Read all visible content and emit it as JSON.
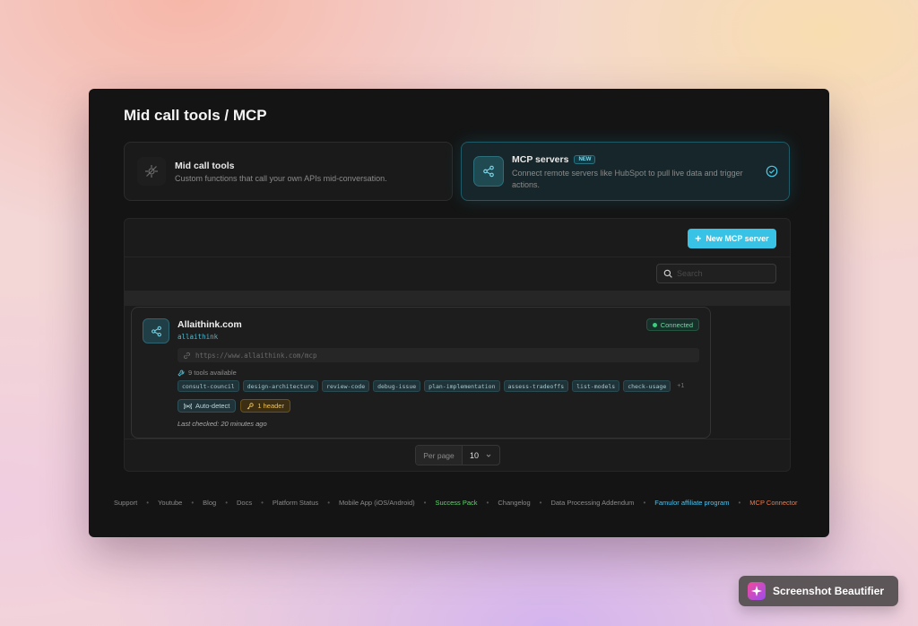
{
  "page": {
    "title": "Mid call tools / MCP"
  },
  "options": [
    {
      "title": "Mid call tools",
      "description": "Custom functions that call your own APIs mid-conversation.",
      "icon": "network-off-icon"
    },
    {
      "title": "MCP servers",
      "badge": "NEW",
      "description": "Connect remote servers like HubSpot to pull live data and trigger actions.",
      "icon": "share-icon",
      "selected": true
    }
  ],
  "toolbar": {
    "new_button_label": "New MCP server"
  },
  "search": {
    "placeholder": "Search"
  },
  "server": {
    "name": "Allaithink.com",
    "slug": "allaithink",
    "status": "Connected",
    "url": "https://www.allaithink.com/mcp",
    "tools_count": "9 tools available",
    "tools": [
      "consult-council",
      "design-architecture",
      "review-code",
      "debug-issue",
      "plan-implementation",
      "assess-tradeoffs",
      "list-models",
      "check-usage"
    ],
    "tools_more": "+1",
    "auto_detect": "Auto-detect",
    "headers": "1 header",
    "last_checked": "Last checked: 20 minutes ago"
  },
  "pagination": {
    "label": "Per page",
    "value": "10"
  },
  "footer": {
    "links": [
      "Support",
      "Youtube",
      "Blog",
      "Docs",
      "Platform Status",
      "Mobile App (iOS/Android)",
      "Success Pack",
      "Changelog",
      "Data Processing Addendum",
      "Famulor affiliate program",
      "MCP Connector"
    ],
    "colors": {
      "success_pack": "#5ad86a",
      "affiliate": "#4cc3f0",
      "mcp_connector": "#f07a4a"
    }
  },
  "overlay": {
    "label": "Screenshot Beautifier"
  },
  "colors": {
    "accent": "#38c3e6",
    "window_bg": "#141414",
    "connected": "#3ecb7f"
  }
}
